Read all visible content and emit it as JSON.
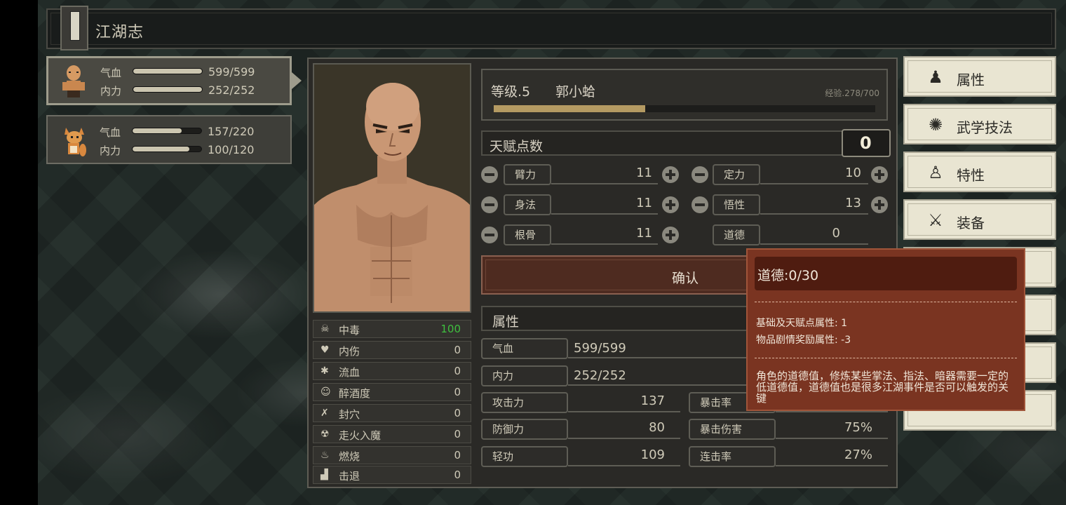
{
  "window": {
    "title": "江湖志"
  },
  "party": [
    {
      "hp_label": "气血",
      "hp_value": "599/599",
      "hp_fill": 1.0,
      "mp_label": "内力",
      "mp_value": "252/252",
      "mp_fill": 1.0
    },
    {
      "hp_label": "气血",
      "hp_value": "157/220",
      "hp_fill": 0.71,
      "mp_label": "内力",
      "mp_value": "100/120",
      "mp_fill": 0.83
    }
  ],
  "character": {
    "level_label": "等级.5",
    "name": "郭小蛤",
    "exp_text": "经验.278/700",
    "exp_fill": 0.397
  },
  "talent": {
    "label": "天赋点数",
    "value": "0"
  },
  "attributes": [
    {
      "label": "臂力",
      "value": "11"
    },
    {
      "label": "定力",
      "value": "10"
    },
    {
      "label": "身法",
      "value": "11"
    },
    {
      "label": "悟性",
      "value": "13"
    },
    {
      "label": "根骨",
      "value": "11"
    },
    {
      "label": "道德",
      "value": "0"
    }
  ],
  "confirm_label": "确认",
  "props_header": "属性",
  "vitals": [
    {
      "label": "气血",
      "value": "599/599"
    },
    {
      "label": "内力",
      "value": "252/252"
    }
  ],
  "combat": [
    {
      "label": "攻击力",
      "value": "137"
    },
    {
      "label": "暴击率",
      "value": ""
    },
    {
      "label": "防御力",
      "value": "80"
    },
    {
      "label": "暴击伤害",
      "value": "75%"
    },
    {
      "label": "轻功",
      "value": "109"
    },
    {
      "label": "连击率",
      "value": "27%"
    }
  ],
  "status_effects": [
    {
      "icon": "skull-icon",
      "glyph": "☠",
      "label": "中毒",
      "value": "100",
      "color": "#3fbf3f"
    },
    {
      "icon": "broken-heart-icon",
      "glyph": "♥",
      "label": "内伤",
      "value": "0",
      "color": "#cfcab8"
    },
    {
      "icon": "blood-drop-icon",
      "glyph": "✱",
      "label": "流血",
      "value": "0",
      "color": "#cfcab8"
    },
    {
      "icon": "drunk-face-icon",
      "glyph": "☺",
      "label": "醉酒度",
      "value": "0",
      "color": "#cfcab8"
    },
    {
      "icon": "acupoint-icon",
      "glyph": "✗",
      "label": "封穴",
      "value": "0",
      "color": "#cfcab8"
    },
    {
      "icon": "madness-icon",
      "glyph": "☢",
      "label": "走火入魔",
      "value": "0",
      "color": "#cfcab8"
    },
    {
      "icon": "flame-icon",
      "glyph": "♨",
      "label": "燃烧",
      "value": "0",
      "color": "#cfcab8"
    },
    {
      "icon": "knockback-icon",
      "glyph": "▟",
      "label": "击退",
      "value": "0",
      "color": "#cfcab8"
    }
  ],
  "side_menu": [
    {
      "label": "属性",
      "icon": "character-icon"
    },
    {
      "label": "武学技法",
      "icon": "martial-arts-icon"
    },
    {
      "label": "特性",
      "icon": "trait-icon"
    },
    {
      "label": "装备",
      "icon": "sword-icon"
    }
  ],
  "tooltip": {
    "title": "道德:0/30",
    "line1": "基础及天赋点属性: 1",
    "line2": "物品剧情奖励属性: -3",
    "description": "角色的道德值，修炼某些掌法、指法、暗器需要一定的低道德值，道德值也是很多江湖事件是否可以触发的关键"
  }
}
